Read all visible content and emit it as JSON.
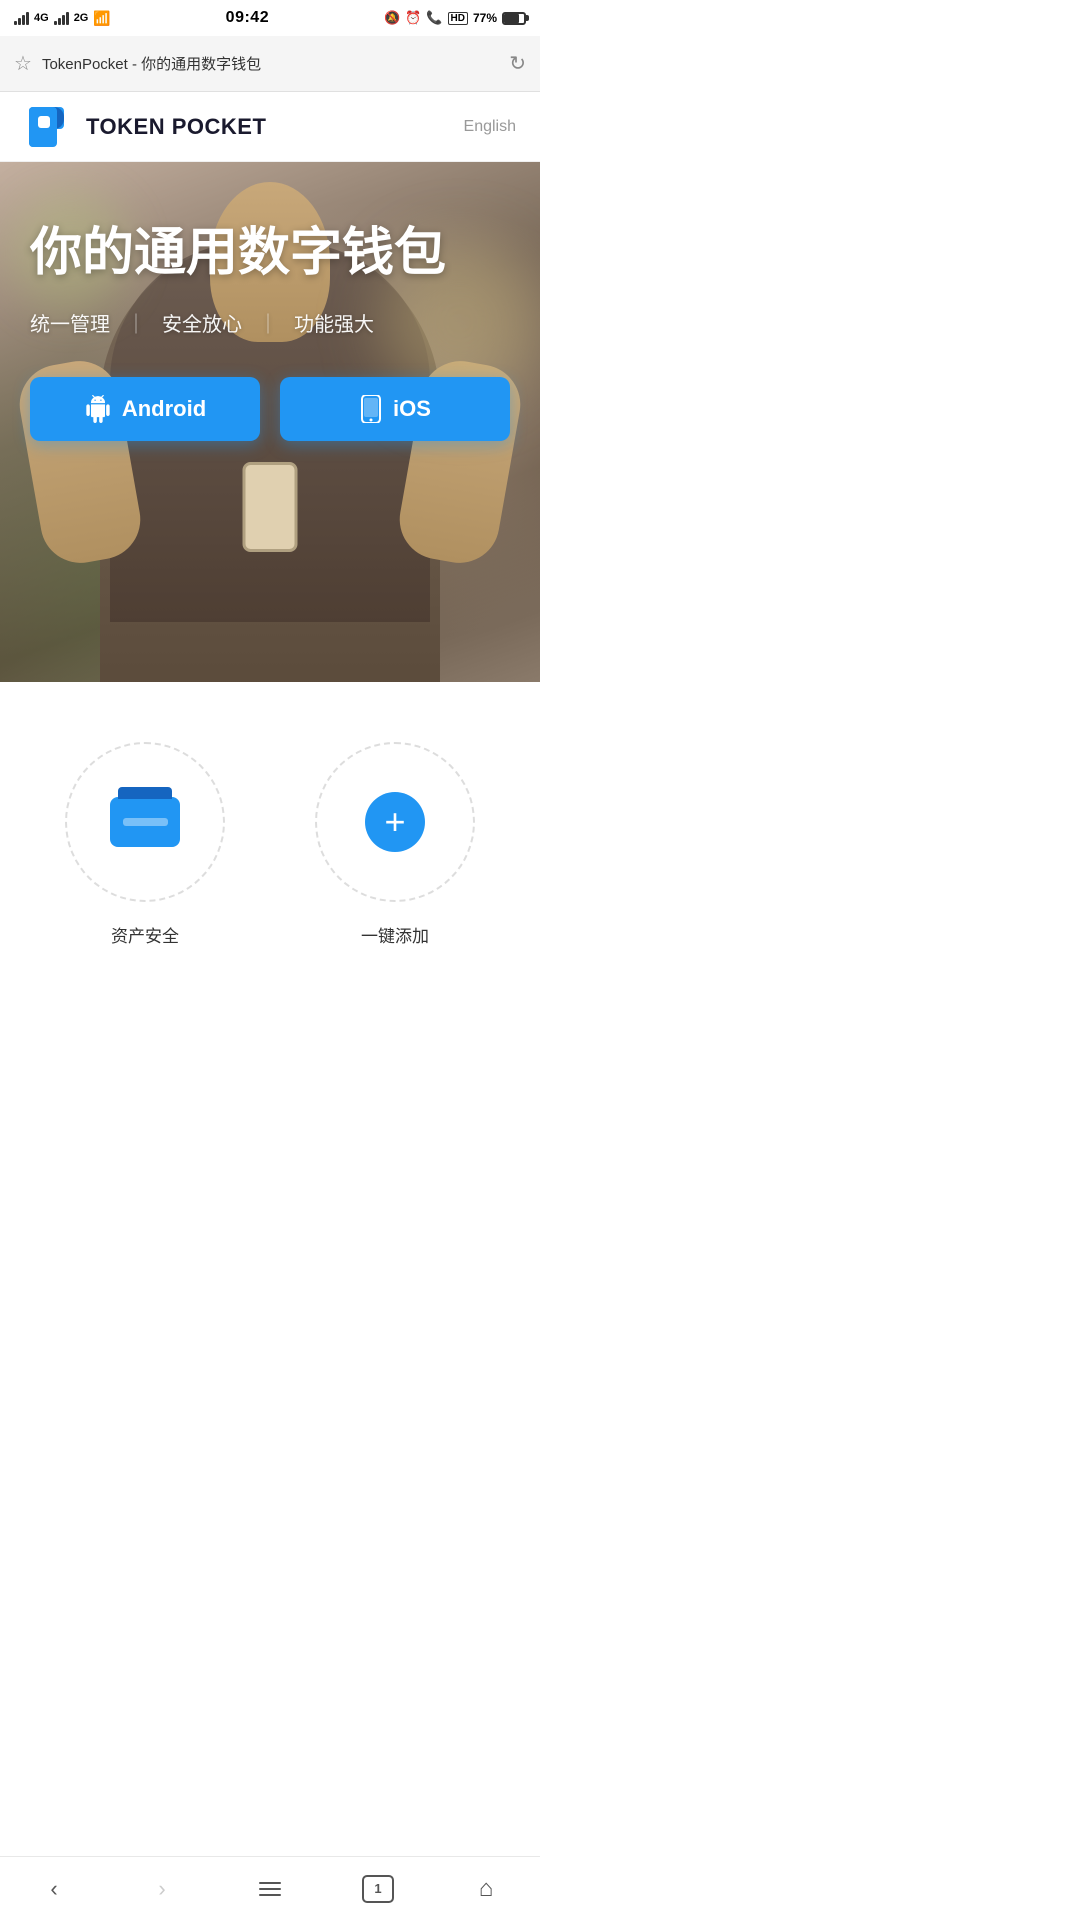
{
  "status_bar": {
    "signal1": "4G",
    "signal2": "2G",
    "time": "09:42",
    "battery_percent": "77%"
  },
  "browser": {
    "title": "TokenPocket - 你的通用数字钱包",
    "star_icon": "☆",
    "refresh_icon": "↻"
  },
  "header": {
    "logo_text": "TOKEN POCKET",
    "lang_btn": "English"
  },
  "hero": {
    "title": "你的通用数字钱包",
    "subtitle_items": [
      "统一管理",
      "安全放心",
      "功能强大"
    ],
    "btn_android": "Android",
    "btn_ios": "iOS"
  },
  "features": [
    {
      "icon": "wallet",
      "label": "资产安全"
    },
    {
      "icon": "plus",
      "label": "一键添加"
    }
  ],
  "nav": {
    "back": "‹",
    "forward": "›",
    "tab_count": "1"
  }
}
